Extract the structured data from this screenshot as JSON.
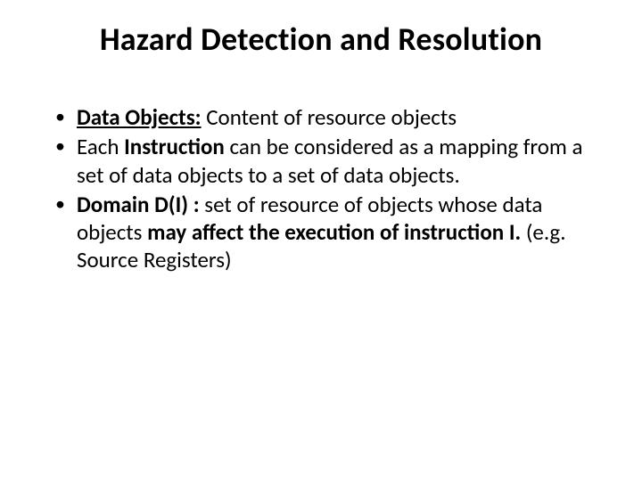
{
  "title": "Hazard Detection and Resolution",
  "bullets": {
    "b1": {
      "label_bold": "Data Objects:",
      "text": " Content of resource objects"
    },
    "b2": {
      "pre": "Each ",
      "bold": "Instruction",
      "post": " can be considered as a mapping from a set of data objects to a set of data objects."
    },
    "b3": {
      "bold1": "Domain D(I) : ",
      "mid1": "set of resource of objects whose data objects ",
      "bold2": "may affect the execution of instruction I. ",
      "mid2": "(e.g. Source Registers)"
    }
  }
}
